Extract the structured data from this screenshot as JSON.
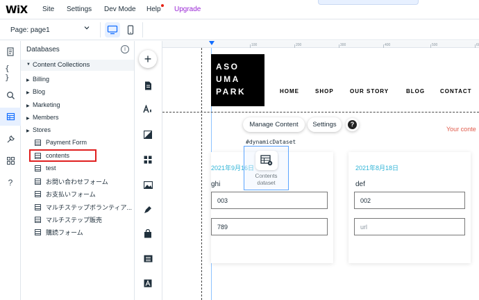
{
  "topbar": {
    "logo": "WiX",
    "menu": [
      "Site",
      "Settings",
      "Dev Mode",
      "Help",
      "Upgrade"
    ]
  },
  "pagebar": {
    "page_label": "Page: page1"
  },
  "colors": {
    "accent": "#116dff",
    "upgrade": "#9a27d5",
    "highlight": "#e01f1f",
    "date": "#2eb3d6"
  },
  "db_panel": {
    "title": "Databases",
    "section": "Content Collections",
    "folders": [
      "Billing",
      "Blog",
      "Marketing",
      "Members",
      "Stores"
    ],
    "collections": [
      "Payment Form",
      "contents",
      "test",
      "お問い合わせフォーム",
      "お支払いフォーム",
      "マルチステップボランティア...",
      "マルチステップ販売",
      "購読フォーム"
    ]
  },
  "icons": {
    "left_tools": [
      "pages-icon",
      "code-icon",
      "search-icon",
      "database-icon",
      "tools-icon",
      "apps-icon",
      "help-icon"
    ],
    "add_bar": [
      "add-icon",
      "document-icon",
      "text-theme-icon",
      "background-icon",
      "grid-icon",
      "image-icon",
      "pen-icon",
      "bag-icon",
      "list-icon",
      "text-box-icon"
    ]
  },
  "ruler": {
    "ticks": [
      "100",
      "200",
      "300",
      "400",
      "500",
      "600"
    ]
  },
  "site": {
    "logo_lines": [
      "ASO",
      "UMA",
      "PARK"
    ],
    "nav": [
      "HOME",
      "SHOP",
      "OUR STORY",
      "BLOG",
      "CONTACT"
    ],
    "your_content": "Your conte"
  },
  "toolbar": {
    "manage_content": "Manage Content",
    "settings": "Settings",
    "help": "?"
  },
  "dataset": {
    "label": "#dynamicDataset",
    "name_line1": "Contents",
    "name_line2": "dataset"
  },
  "cards": [
    {
      "date": "2021年9月16日",
      "text": "ghi",
      "input1": "003",
      "input2": "789",
      "input2_placeholder": false
    },
    {
      "date": "2021年8月18日",
      "text": "def",
      "input1": "002",
      "input2": "url",
      "input2_placeholder": true
    }
  ]
}
